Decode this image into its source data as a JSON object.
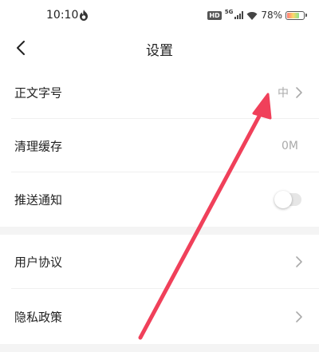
{
  "status_bar": {
    "time": "10:10",
    "hd": "HD",
    "network": "5G",
    "battery": "78%",
    "battery_level": 0.78
  },
  "nav": {
    "title": "设置"
  },
  "settings": {
    "font_size": {
      "label": "正文字号",
      "value": "中"
    },
    "clear_cache": {
      "label": "清理缓存",
      "value": "0M"
    },
    "push": {
      "label": "推送通知",
      "enabled": false
    },
    "user_agreement": {
      "label": "用户协议"
    },
    "privacy_policy": {
      "label": "隐私政策"
    }
  },
  "annotation": {
    "arrow_color": "#f0405a"
  },
  "colors": {
    "section_gap": "#f4f4f4",
    "secondary_text": "#aaaaaa"
  }
}
